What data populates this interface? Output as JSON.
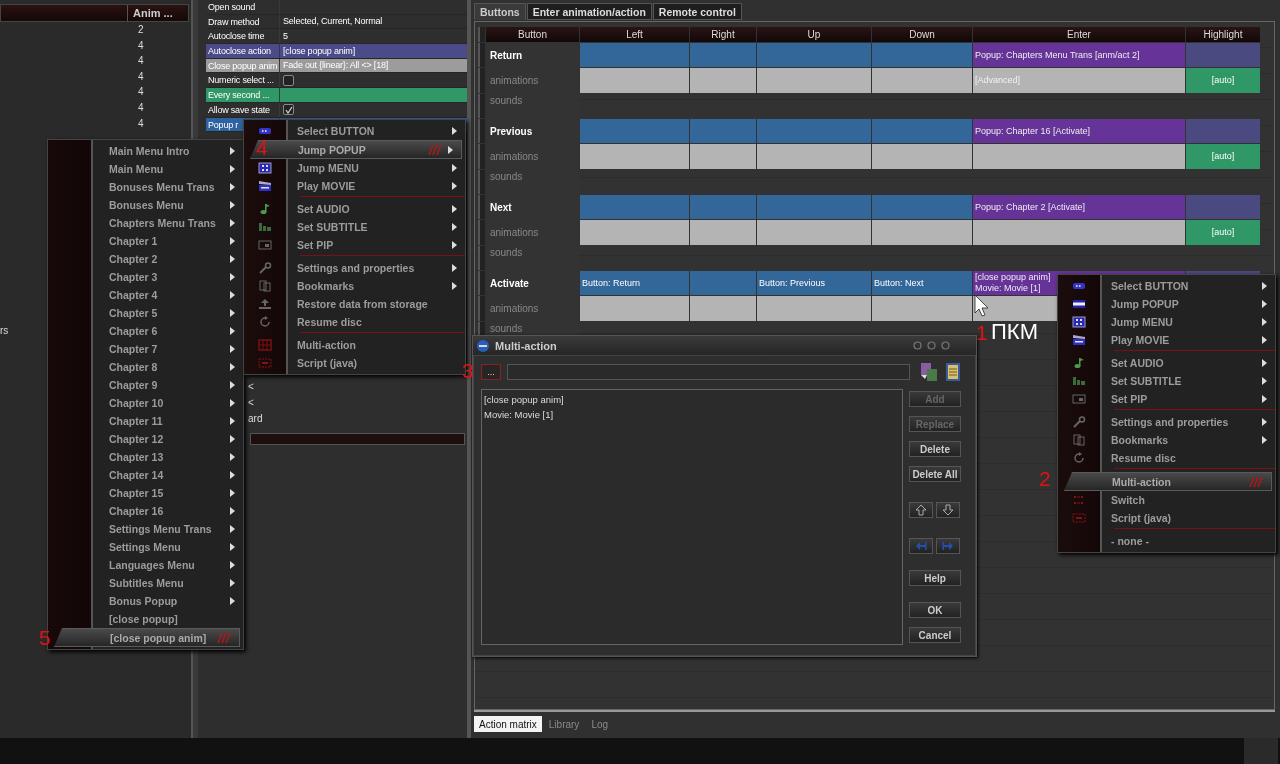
{
  "left_list": {
    "header": "Anim ...",
    "values": [
      "2",
      "4",
      "4",
      "4",
      "4",
      "4",
      "4"
    ],
    "fragment": "rs"
  },
  "properties": [
    {
      "label": "Open sound",
      "kind": "text",
      "selected": false
    },
    {
      "label": "Draw method",
      "value": "Selected, Current, Normal",
      "kind": "text",
      "selected": false
    },
    {
      "label": "Autoclose time",
      "value": "5",
      "kind": "text",
      "selected": false
    },
    {
      "label": "Autoclose action",
      "value": "[close popup anim]",
      "kind": "text",
      "selected": false,
      "color": "#4b4b8a"
    },
    {
      "label": "Close popup anim",
      "value": "Fade out {linear}: All <> [18]",
      "kind": "text",
      "selected": false,
      "color": "#9c9c9c"
    },
    {
      "label": "Numeric select ...",
      "kind": "checkbox",
      "checked": false,
      "selected": false
    },
    {
      "label": "Every second ...",
      "kind": "text",
      "selected": false,
      "color": "#2f9866"
    },
    {
      "label": "Allow save state",
      "kind": "checkbox",
      "checked": true,
      "selected": false
    },
    {
      "label": "Popup r",
      "kind": "text",
      "selected": true
    }
  ],
  "middle_fragments": [
    "<",
    "<",
    "ard"
  ],
  "matrix": {
    "tabs": [
      {
        "label": "Buttons",
        "selected": true
      },
      {
        "label": "Enter animation/action",
        "selected": false
      },
      {
        "label": "Remote control",
        "selected": false
      }
    ],
    "columns": [
      "Button",
      "Left",
      "Right",
      "Up",
      "Down",
      "Enter",
      "Highlight"
    ],
    "buttons": [
      {
        "name": "Return",
        "actions": {
          "enter": [
            "Popup: Chapters Menu Trans [anm/act 2]"
          ]
        },
        "animations_label": "animations",
        "animations": {
          "enter": "[Advanced]",
          "highlight": "[auto]"
        },
        "sounds_label": "sounds"
      },
      {
        "name": "Previous",
        "actions": {
          "enter": [
            "Popup: Chapter 16 [Activate]"
          ]
        },
        "animations_label": "animations",
        "animations": {
          "highlight": "[auto]"
        },
        "sounds_label": "sounds"
      },
      {
        "name": "Next",
        "actions": {
          "enter": [
            "Popup: Chapter 2 [Activate]"
          ]
        },
        "animations_label": "animations",
        "animations": {
          "highlight": "[auto]"
        },
        "sounds_label": "sounds"
      },
      {
        "name": "Activate",
        "actions": {
          "left": [
            "Button: Return"
          ],
          "up": [
            "Button: Previous"
          ],
          "down": [
            "Button: Next"
          ],
          "enter": [
            "[close popup anim]",
            "Movie: Movie [1]"
          ]
        },
        "animations_label": "animations",
        "sounds_label": "sounds"
      }
    ],
    "bottom_tabs": [
      {
        "label": "Action matrix",
        "selected": true
      },
      {
        "label": "Library",
        "selected": false
      },
      {
        "label": "Log",
        "selected": false
      }
    ]
  },
  "popup_submenu": {
    "items": [
      {
        "kind": "item",
        "label": "Main Menu Intro",
        "submenu": true,
        "selected": false
      },
      {
        "kind": "item",
        "label": "Main Menu",
        "submenu": true,
        "selected": false
      },
      {
        "kind": "item",
        "label": "Bonuses Menu Trans",
        "submenu": true,
        "selected": false
      },
      {
        "kind": "item",
        "label": "Bonuses Menu",
        "submenu": true,
        "selected": false
      },
      {
        "kind": "item",
        "label": "Chapters Menu Trans",
        "submenu": true,
        "selected": false
      },
      {
        "kind": "item",
        "label": "Chapter 1",
        "submenu": true,
        "selected": false
      },
      {
        "kind": "item",
        "label": "Chapter 2",
        "submenu": true,
        "selected": false
      },
      {
        "kind": "item",
        "label": "Chapter 3",
        "submenu": true,
        "selected": false
      },
      {
        "kind": "item",
        "label": "Chapter 4",
        "submenu": true,
        "selected": false
      },
      {
        "kind": "item",
        "label": "Chapter 5",
        "submenu": true,
        "selected": false
      },
      {
        "kind": "item",
        "label": "Chapter 6",
        "submenu": true,
        "selected": false
      },
      {
        "kind": "item",
        "label": "Chapter 7",
        "submenu": true,
        "selected": false
      },
      {
        "kind": "item",
        "label": "Chapter 8",
        "submenu": true,
        "selected": false
      },
      {
        "kind": "item",
        "label": "Chapter 9",
        "submenu": true,
        "selected": false
      },
      {
        "kind": "item",
        "label": "Chapter 10",
        "submenu": true,
        "selected": false
      },
      {
        "kind": "item",
        "label": "Chapter 11",
        "submenu": true,
        "selected": false
      },
      {
        "kind": "item",
        "label": "Chapter 12",
        "submenu": true,
        "selected": false
      },
      {
        "kind": "item",
        "label": "Chapter 13",
        "submenu": true,
        "selected": false
      },
      {
        "kind": "item",
        "label": "Chapter 14",
        "submenu": true,
        "selected": false
      },
      {
        "kind": "item",
        "label": "Chapter 15",
        "submenu": true,
        "selected": false
      },
      {
        "kind": "item",
        "label": "Chapter 16",
        "submenu": true,
        "selected": false
      },
      {
        "kind": "item",
        "label": "Settings Menu Trans",
        "submenu": true,
        "selected": false
      },
      {
        "kind": "item",
        "label": "Settings Menu",
        "submenu": true,
        "selected": false
      },
      {
        "kind": "item",
        "label": "Languages Menu",
        "submenu": true,
        "selected": false
      },
      {
        "kind": "item",
        "label": "Subtitles Menu",
        "submenu": true,
        "selected": false
      },
      {
        "kind": "item",
        "label": "Bonus Popup",
        "submenu": true,
        "selected": false
      },
      {
        "kind": "item",
        "label": "[close popup]",
        "submenu": false,
        "selected": false
      },
      {
        "kind": "item",
        "label": "[close popup anim]",
        "submenu": false,
        "selected": true
      }
    ]
  },
  "action_menu": {
    "items": [
      {
        "kind": "item",
        "label": "Select BUTTON",
        "submenu": true,
        "selected": false
      },
      {
        "kind": "item",
        "label": "Jump POPUP",
        "submenu": true,
        "selected": true
      },
      {
        "kind": "item",
        "label": "Jump MENU",
        "submenu": true,
        "selected": false
      },
      {
        "kind": "item",
        "label": "Play MOVIE",
        "submenu": true,
        "selected": false
      },
      {
        "kind": "separator"
      },
      {
        "kind": "item",
        "label": "Set AUDIO",
        "submenu": true,
        "selected": false
      },
      {
        "kind": "item",
        "label": "Set SUBTITLE",
        "submenu": true,
        "selected": false
      },
      {
        "kind": "item",
        "label": "Set PIP",
        "submenu": true,
        "selected": false
      },
      {
        "kind": "separator"
      },
      {
        "kind": "item",
        "label": "Settings and properties",
        "submenu": true,
        "selected": false
      },
      {
        "kind": "item",
        "label": "Bookmarks",
        "submenu": true,
        "selected": false
      },
      {
        "kind": "item",
        "label": "Restore data from storage",
        "submenu": false,
        "selected": false
      },
      {
        "kind": "item",
        "label": "Resume disc",
        "submenu": false,
        "selected": false
      },
      {
        "kind": "separator"
      },
      {
        "kind": "item",
        "label": "Multi-action",
        "submenu": false,
        "selected": false
      },
      {
        "kind": "item",
        "label": "Script (java)",
        "submenu": false,
        "selected": false
      }
    ]
  },
  "dialog": {
    "title": "Multi-action",
    "browse_button": "...",
    "entries": [
      "[close popup anim]",
      "Movie: Movie [1]"
    ],
    "button_groups": [
      [
        {
          "kind": "text",
          "label": "Add",
          "disabled": true
        },
        {
          "kind": "text",
          "label": "Replace",
          "disabled": true
        },
        {
          "kind": "text",
          "label": "Delete",
          "disabled": false
        },
        {
          "kind": "text",
          "label": "Delete All",
          "disabled": false
        }
      ],
      [
        {
          "kind": "up"
        },
        {
          "kind": "down"
        }
      ],
      [
        {
          "kind": "left"
        },
        {
          "kind": "right"
        }
      ],
      [
        {
          "kind": "text",
          "label": "Help",
          "disabled": false
        }
      ],
      [
        {
          "kind": "text",
          "label": "OK",
          "disabled": false
        },
        {
          "kind": "text",
          "label": "Cancel",
          "disabled": false
        }
      ]
    ]
  },
  "context_menu": {
    "items": [
      {
        "kind": "item",
        "label": "Select BUTTON",
        "submenu": true,
        "selected": false
      },
      {
        "kind": "item",
        "label": "Jump POPUP",
        "submenu": true,
        "selected": false
      },
      {
        "kind": "item",
        "label": "Jump MENU",
        "submenu": true,
        "selected": false
      },
      {
        "kind": "item",
        "label": "Play MOVIE",
        "submenu": true,
        "selected": false
      },
      {
        "kind": "separator"
      },
      {
        "kind": "item",
        "label": "Set AUDIO",
        "submenu": true,
        "selected": false
      },
      {
        "kind": "item",
        "label": "Set SUBTITLE",
        "submenu": true,
        "selected": false
      },
      {
        "kind": "item",
        "label": "Set PIP",
        "submenu": true,
        "selected": false
      },
      {
        "kind": "separator"
      },
      {
        "kind": "item",
        "label": "Settings and properties",
        "submenu": true,
        "selected": false
      },
      {
        "kind": "item",
        "label": "Bookmarks",
        "submenu": true,
        "selected": false
      },
      {
        "kind": "item",
        "label": "Resume disc",
        "submenu": false,
        "selected": false
      },
      {
        "kind": "separator"
      },
      {
        "kind": "item",
        "label": "Multi-action",
        "submenu": false,
        "selected": true
      },
      {
        "kind": "item",
        "label": "Switch",
        "submenu": false,
        "selected": false
      },
      {
        "kind": "item",
        "label": "Script (java)",
        "submenu": false,
        "selected": false
      },
      {
        "kind": "separator"
      },
      {
        "kind": "item",
        "label": "- none -",
        "submenu": false,
        "selected": false
      }
    ]
  },
  "annotations": [
    "1",
    "2",
    "3",
    "4",
    "5"
  ],
  "click_note": "ПКМ"
}
